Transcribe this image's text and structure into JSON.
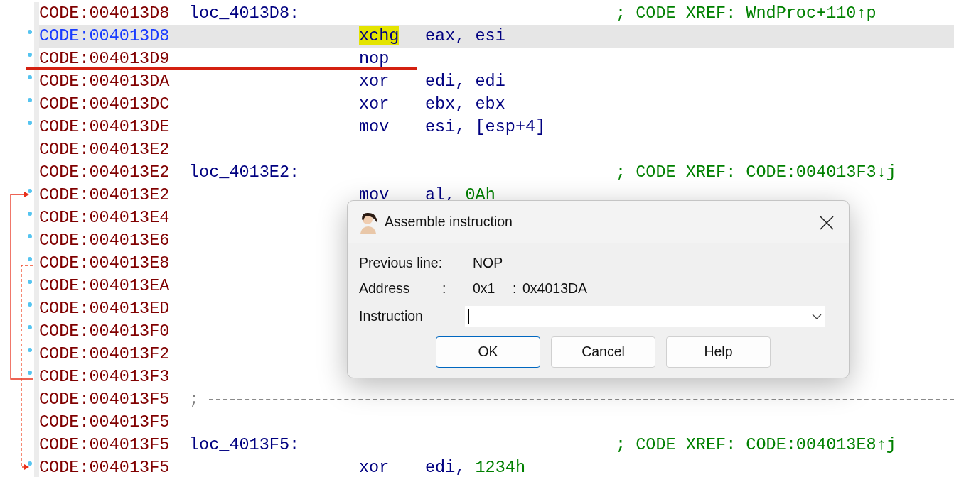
{
  "listing": {
    "rows": [
      {
        "address": "CODE:004013D8",
        "label": "loc_4013D8:",
        "comment": "; CODE XREF: WndProc+110↑p",
        "dot": false,
        "selected": false
      },
      {
        "address": "CODE:004013D8",
        "mnemonic": "xchg",
        "operands": [
          {
            "text": "eax, esi"
          }
        ],
        "dot": true,
        "selected": true,
        "highlighted": true
      },
      {
        "address": "CODE:004013D9",
        "mnemonic": "nop",
        "dot": true,
        "selected": false,
        "underlined": true
      },
      {
        "address": "CODE:004013DA",
        "mnemonic": "xor",
        "operands": [
          {
            "text": "edi, edi"
          }
        ],
        "dot": true,
        "selected": false
      },
      {
        "address": "CODE:004013DC",
        "mnemonic": "xor",
        "operands": [
          {
            "text": "ebx, ebx"
          }
        ],
        "dot": true,
        "selected": false
      },
      {
        "address": "CODE:004013DE",
        "mnemonic": "mov",
        "operands": [
          {
            "text": "esi, [esp+4]"
          }
        ],
        "dot": true,
        "selected": false
      },
      {
        "address": "CODE:004013E2",
        "dot": false,
        "selected": false
      },
      {
        "address": "CODE:004013E2",
        "label": "loc_4013E2:",
        "comment": "; CODE XREF: CODE:004013F3↓j",
        "dot": false,
        "selected": false
      },
      {
        "address": "CODE:004013E2",
        "mnemonic": "mov",
        "operands": [
          {
            "text": "al, "
          },
          {
            "text": "0Ah",
            "kind": "number"
          }
        ],
        "dot": true,
        "selected": false,
        "arrow_in": {
          "kind": "solid"
        }
      },
      {
        "address": "CODE:004013E4",
        "dot": true,
        "selected": false
      },
      {
        "address": "CODE:004013E6",
        "dot": true,
        "selected": false
      },
      {
        "address": "CODE:004013E8",
        "dot": true,
        "selected": false,
        "arrow_out": {
          "kind": "dashed"
        }
      },
      {
        "address": "CODE:004013EA",
        "dot": true,
        "selected": false
      },
      {
        "address": "CODE:004013ED",
        "dot": true,
        "selected": false
      },
      {
        "address": "CODE:004013F0",
        "dot": true,
        "selected": false
      },
      {
        "address": "CODE:004013F2",
        "dot": true,
        "selected": false
      },
      {
        "address": "CODE:004013F3",
        "dot": true,
        "selected": false,
        "arrow_out": {
          "kind": "solid"
        }
      },
      {
        "address": "CODE:004013F5",
        "separator": ";",
        "dot": false,
        "selected": false
      },
      {
        "address": "CODE:004013F5",
        "dot": false,
        "selected": false
      },
      {
        "address": "CODE:004013F5",
        "label": "loc_4013F5:",
        "comment": "; CODE XREF: CODE:004013E8↑j",
        "dot": false,
        "selected": false
      },
      {
        "address": "CODE:004013F5",
        "mnemonic": "xor",
        "operands": [
          {
            "text": "edi, "
          },
          {
            "text": "1234h",
            "kind": "number"
          }
        ],
        "dot": true,
        "selected": false,
        "arrow_in": {
          "kind": "dashed"
        }
      }
    ]
  },
  "dialog": {
    "title": "Assemble instruction",
    "previous_line": {
      "label": "Previous line:",
      "value": "NOP"
    },
    "address": {
      "label": "Address",
      "sep1": ":",
      "value1": "0x1",
      "sep2": ":",
      "value2": "0x4013DA"
    },
    "instruction": {
      "label": "Instruction"
    },
    "buttons": [
      {
        "label": "OK",
        "default": true
      },
      {
        "label": "Cancel",
        "default": false
      },
      {
        "label": "Help",
        "default": false
      }
    ]
  }
}
